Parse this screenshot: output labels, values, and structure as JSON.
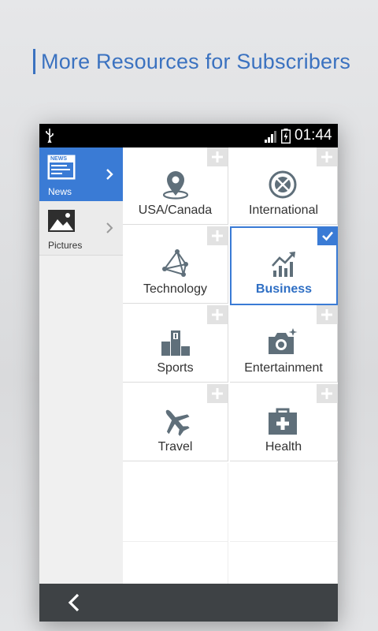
{
  "headline": "More Resources for Subscribers",
  "status_bar": {
    "time": "01:44"
  },
  "sidebar": {
    "items": [
      {
        "label": "News",
        "icon": "newspaper-icon",
        "selected": true
      },
      {
        "label": "Pictures",
        "icon": "picture-icon",
        "selected": false
      }
    ]
  },
  "categories": [
    {
      "label": "USA/Canada",
      "icon": "location-pin-icon",
      "selected": false
    },
    {
      "label": "International",
      "icon": "globe-icon",
      "selected": false
    },
    {
      "label": "Technology",
      "icon": "network-icon",
      "selected": false
    },
    {
      "label": "Business",
      "icon": "chart-icon",
      "selected": true
    },
    {
      "label": "Sports",
      "icon": "podium-icon",
      "selected": false
    },
    {
      "label": "Entertainment",
      "icon": "camera-icon",
      "selected": false
    },
    {
      "label": "Travel",
      "icon": "airplane-icon",
      "selected": false
    },
    {
      "label": "Health",
      "icon": "first-aid-kit-icon",
      "selected": false
    }
  ],
  "colors": {
    "accent": "#3a7bd5",
    "headline": "#3b72c0",
    "icon_gray": "#5f6f7a",
    "navbar": "#3e4245"
  }
}
